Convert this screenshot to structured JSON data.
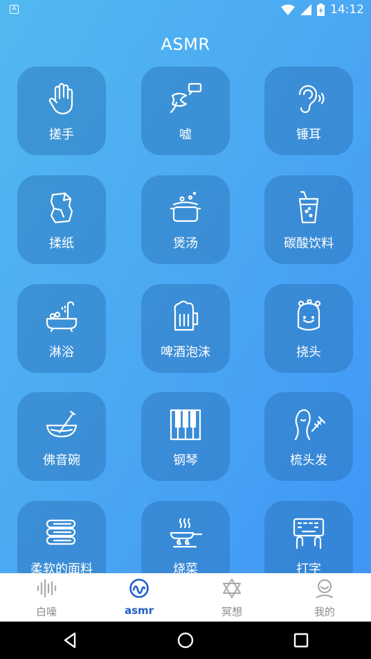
{
  "status_bar": {
    "left_icon": "A",
    "time": "14:12",
    "icons": [
      "wifi-icon",
      "signal-icon",
      "battery-icon"
    ]
  },
  "page_title": "ASMR",
  "tiles": [
    {
      "label": "搓手",
      "icon": "hand-icon"
    },
    {
      "label": "嘘",
      "icon": "whisper-icon"
    },
    {
      "label": "锤耳",
      "icon": "ear-icon"
    },
    {
      "label": "揉纸",
      "icon": "crumpled-paper-icon"
    },
    {
      "label": "煲汤",
      "icon": "soup-pot-icon"
    },
    {
      "label": "碳酸饮料",
      "icon": "soda-glass-icon"
    },
    {
      "label": "淋浴",
      "icon": "bathtub-icon"
    },
    {
      "label": "啤酒泡沫",
      "icon": "beer-mug-icon"
    },
    {
      "label": "挠头",
      "icon": "head-scratch-icon"
    },
    {
      "label": "佛音碗",
      "icon": "singing-bowl-icon"
    },
    {
      "label": "钢琴",
      "icon": "piano-icon"
    },
    {
      "label": "梳头发",
      "icon": "comb-hair-icon"
    },
    {
      "label": "柔软的面料",
      "icon": "folded-fabric-icon"
    },
    {
      "label": "烧菜",
      "icon": "frying-pan-icon"
    },
    {
      "label": "打字",
      "icon": "keyboard-typing-icon"
    }
  ],
  "tabs": [
    {
      "label": "白噪",
      "icon": "sound-wave-icon"
    },
    {
      "label": "asmr",
      "icon": "asmr-wave-icon",
      "active": true
    },
    {
      "label": "冥想",
      "icon": "star-of-david-icon"
    },
    {
      "label": "我的",
      "icon": "user-icon"
    }
  ],
  "colors": {
    "gradient_start": "#52b9f0",
    "gradient_end": "#3f96f7",
    "tile_bg": "rgba(40,110,180,0.45)",
    "active_tab": "#1f5ec7",
    "inactive_tab": "#8b8b8b"
  }
}
